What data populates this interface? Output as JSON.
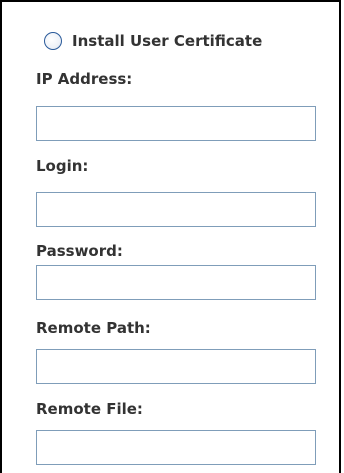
{
  "radio_option": {
    "label": "Install User Certificate",
    "checked": false
  },
  "fields": [
    {
      "label": "IP Address:",
      "value": "",
      "placeholder": ""
    },
    {
      "label": "Login:",
      "value": "",
      "placeholder": ""
    },
    {
      "label": "Password:",
      "value": "",
      "placeholder": ""
    },
    {
      "label": "Remote Path:",
      "value": "",
      "placeholder": ""
    },
    {
      "label": "Remote File:",
      "value": "",
      "placeholder": ""
    }
  ],
  "colors": {
    "border": "#000000",
    "input_border": "#7f9db9",
    "radio_border": "#2a5a9a",
    "text": "#333333"
  }
}
